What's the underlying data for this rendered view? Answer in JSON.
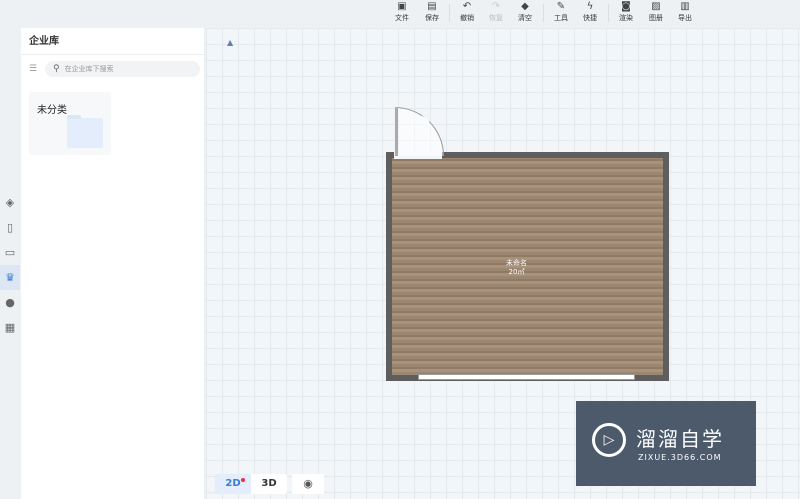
{
  "toolbar": {
    "items": [
      {
        "label": "文件",
        "icon": "file-icon",
        "enabled": true
      },
      {
        "label": "保存",
        "icon": "save-icon",
        "enabled": true
      },
      {
        "label": "撤销",
        "icon": "undo-icon",
        "enabled": true
      },
      {
        "label": "恢复",
        "icon": "redo-icon",
        "enabled": false
      },
      {
        "label": "清空",
        "icon": "eraser-icon",
        "enabled": true
      },
      {
        "label": "工具",
        "icon": "wrench-icon",
        "enabled": true
      },
      {
        "label": "快捷",
        "icon": "lightning-icon",
        "enabled": true
      },
      {
        "label": "渲染",
        "icon": "camera-icon",
        "enabled": true
      },
      {
        "label": "图册",
        "icon": "album-icon",
        "enabled": true
      },
      {
        "label": "导出",
        "icon": "export-icon",
        "enabled": true
      }
    ]
  },
  "panel": {
    "title": "企业库",
    "search_placeholder": "在企业库下搜索",
    "folders": [
      {
        "name": "未分类"
      }
    ]
  },
  "room": {
    "name": "未命名",
    "area": "20㎡"
  },
  "view": {
    "mode_2d": "2D",
    "mode_3d": "3D",
    "active": "2D"
  },
  "watermark": {
    "title": "溜溜自学",
    "url": "ZIXUE.3D66.COM"
  },
  "colors": {
    "accent": "#3a7bd5",
    "wall": "#5e5e5e"
  }
}
